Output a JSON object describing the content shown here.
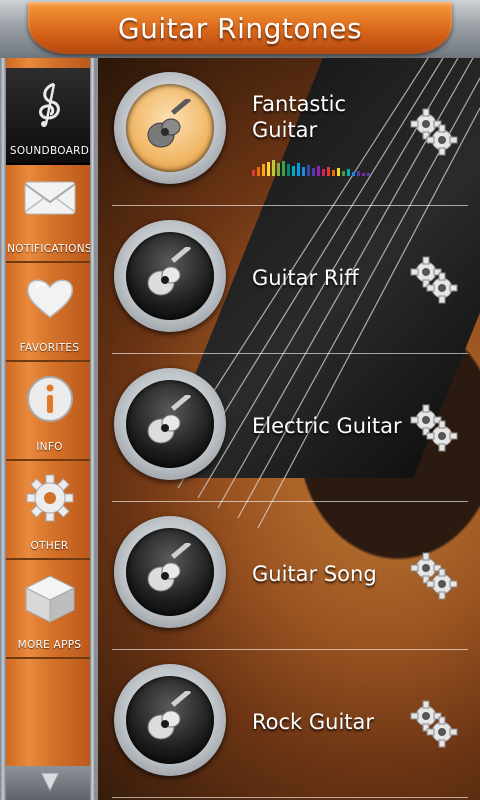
{
  "header": {
    "title": "Guitar Ringtones"
  },
  "sidebar": {
    "items": [
      {
        "label": "SOUNDBOARD",
        "icon": "treble-clef-icon",
        "active": true
      },
      {
        "label": "NOTIFICATIONS",
        "icon": "envelope-icon",
        "active": false
      },
      {
        "label": "FAVORITES",
        "icon": "heart-icon",
        "active": false
      },
      {
        "label": "INFO",
        "icon": "info-icon",
        "active": false
      },
      {
        "label": "OTHER",
        "icon": "gear-icon",
        "active": false
      },
      {
        "label": "MORE APPS",
        "icon": "box-icon",
        "active": false
      }
    ],
    "scroll_icon": "arrow-down-icon"
  },
  "ringtones": [
    {
      "line1": "Fantastic",
      "line2": "Guitar",
      "playing": true
    },
    {
      "line1": "Guitar Riff",
      "line2": "",
      "playing": false
    },
    {
      "line1": "Electric Guitar",
      "line2": "",
      "playing": false
    },
    {
      "line1": "Guitar Song",
      "line2": "",
      "playing": false
    },
    {
      "line1": "Rock Guitar",
      "line2": "",
      "playing": false
    }
  ],
  "colors": {
    "accent": "#e07a28",
    "chrome": "#aeb3b8",
    "active_sidebar": "#111111"
  }
}
